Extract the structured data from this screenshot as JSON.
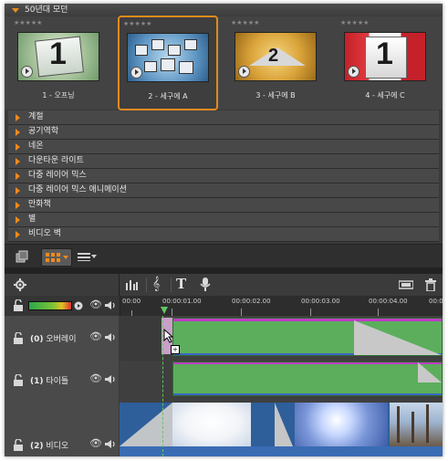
{
  "library": {
    "group_title": "50년대 모던",
    "themes": [
      {
        "label": "1 - 오프닝",
        "number": "1"
      },
      {
        "label": "2 - 세구에 A",
        "number": "",
        "selected": true
      },
      {
        "label": "3 - 세구에 B",
        "number": "2"
      },
      {
        "label": "4 - 세구에 C",
        "number": "1"
      }
    ],
    "categories": [
      "계절",
      "공기역학",
      "네온",
      "다운타운 라이트",
      "다중 레이어 믹스",
      "다중 레이어 믹스 애니메이션",
      "만화책",
      "별",
      "비디오 벽"
    ]
  },
  "timeline": {
    "ruler_ticks": [
      "00:00",
      "00:00:01.00",
      "00:00:02.00",
      "00:00:03.00",
      "00:00:04.00",
      "00:00"
    ],
    "tracks": [
      {
        "number": "(0)",
        "name": "오버레이"
      },
      {
        "number": "(1)",
        "name": "타이틀"
      },
      {
        "number": "(2)",
        "name": "비디오"
      }
    ]
  },
  "colors": {
    "accent": "#e08a1e",
    "clip_green": "#5cae5c",
    "clip_magenta": "#c03cc8"
  },
  "icons": [
    "play-icon",
    "storyboard-view-icon",
    "list-view-icon",
    "settings-icon",
    "audio-mixer-icon",
    "music-note-icon",
    "title-icon",
    "microphone-icon",
    "lock-icon",
    "eye-icon",
    "speaker-icon",
    "trash-icon"
  ]
}
